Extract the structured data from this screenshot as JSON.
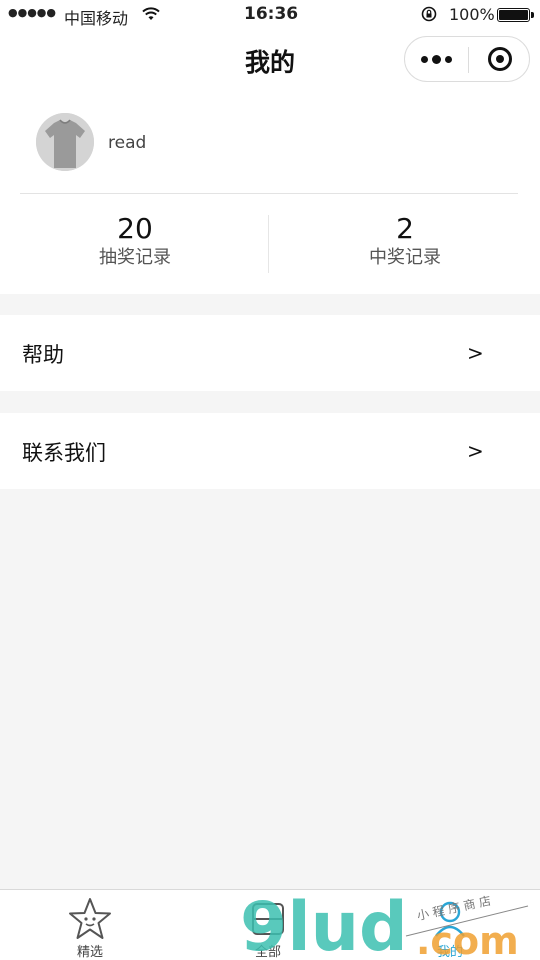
{
  "status_bar": {
    "signal": "●●●●●",
    "carrier": "中国移动",
    "time": "16:36",
    "battery": "100%"
  },
  "nav": {
    "title": "我的"
  },
  "profile": {
    "username": "read"
  },
  "stats": [
    {
      "value": "20",
      "label": "抽奖记录"
    },
    {
      "value": "2",
      "label": "中奖记录"
    }
  ],
  "menu": [
    {
      "label": "帮助",
      "arrow": ">"
    },
    {
      "label": "联系我们",
      "arrow": ">"
    }
  ],
  "tabs": [
    {
      "label": "精选",
      "icon": "star-icon"
    },
    {
      "label": "全部",
      "icon": "grid-icon"
    },
    {
      "label": "我的",
      "icon": "user-icon"
    }
  ],
  "watermark": {
    "brand": "9lud",
    "suffix": ".com",
    "tagline": "小 程 序 商 店"
  },
  "colors": {
    "active_tab": "#2aa6d6",
    "page_background": "#f5f5f5"
  }
}
